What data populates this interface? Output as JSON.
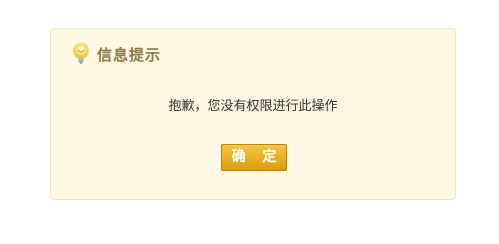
{
  "dialog": {
    "title": "信息提示",
    "icon": "lightbulb-icon",
    "message": "抱歉，您没有权限进行此操作",
    "confirm_label": "确 定"
  },
  "colors": {
    "dialog_background": "#fff8e3",
    "dialog_border": "#f2e3bc",
    "title_text": "#8a7a4a",
    "button_gradient_top": "#f2c542",
    "button_gradient_bottom": "#dc9d0c",
    "icon_yellow": "#f4dc5a"
  }
}
